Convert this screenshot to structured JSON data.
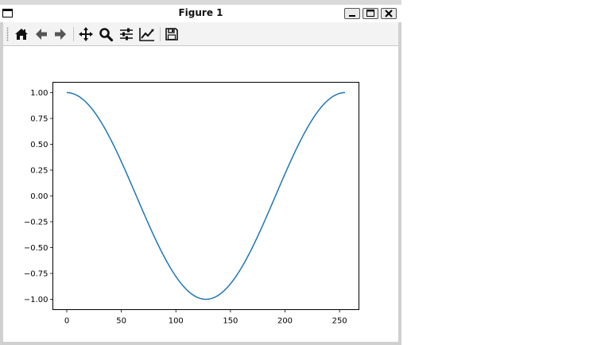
{
  "window": {
    "title": "Figure 1",
    "buttons": [
      "minimize",
      "maximize",
      "close"
    ]
  },
  "toolbar": {
    "tools": [
      {
        "name": "home-icon"
      },
      {
        "name": "back-icon"
      },
      {
        "name": "forward-icon"
      },
      {
        "name": "pan-icon"
      },
      {
        "name": "zoom-icon"
      },
      {
        "name": "configure-subplots-icon"
      },
      {
        "name": "edit-axis-icon"
      },
      {
        "name": "save-icon"
      }
    ]
  },
  "colors": {
    "line": "#1f77b4"
  },
  "chart_data": {
    "type": "line",
    "title": "",
    "xlabel": "",
    "ylabel": "",
    "xlim": [
      -12.75,
      267.75
    ],
    "ylim": [
      -1.1,
      1.1
    ],
    "xticks": [
      0,
      50,
      100,
      150,
      200,
      250
    ],
    "xtick_labels": [
      "0",
      "50",
      "100",
      "150",
      "200",
      "250"
    ],
    "yticks": [
      -1.0,
      -0.75,
      -0.5,
      -0.25,
      0.0,
      0.25,
      0.5,
      0.75,
      1.0
    ],
    "ytick_labels": [
      "−1.00",
      "−0.75",
      "−0.50",
      "−0.25",
      "0.00",
      "0.25",
      "0.50",
      "0.75",
      "1.00"
    ],
    "grid": false,
    "series": [
      {
        "x_start": 0,
        "x_end": 255,
        "points": 256,
        "function": "cos(2*pi*x/255)"
      }
    ]
  }
}
